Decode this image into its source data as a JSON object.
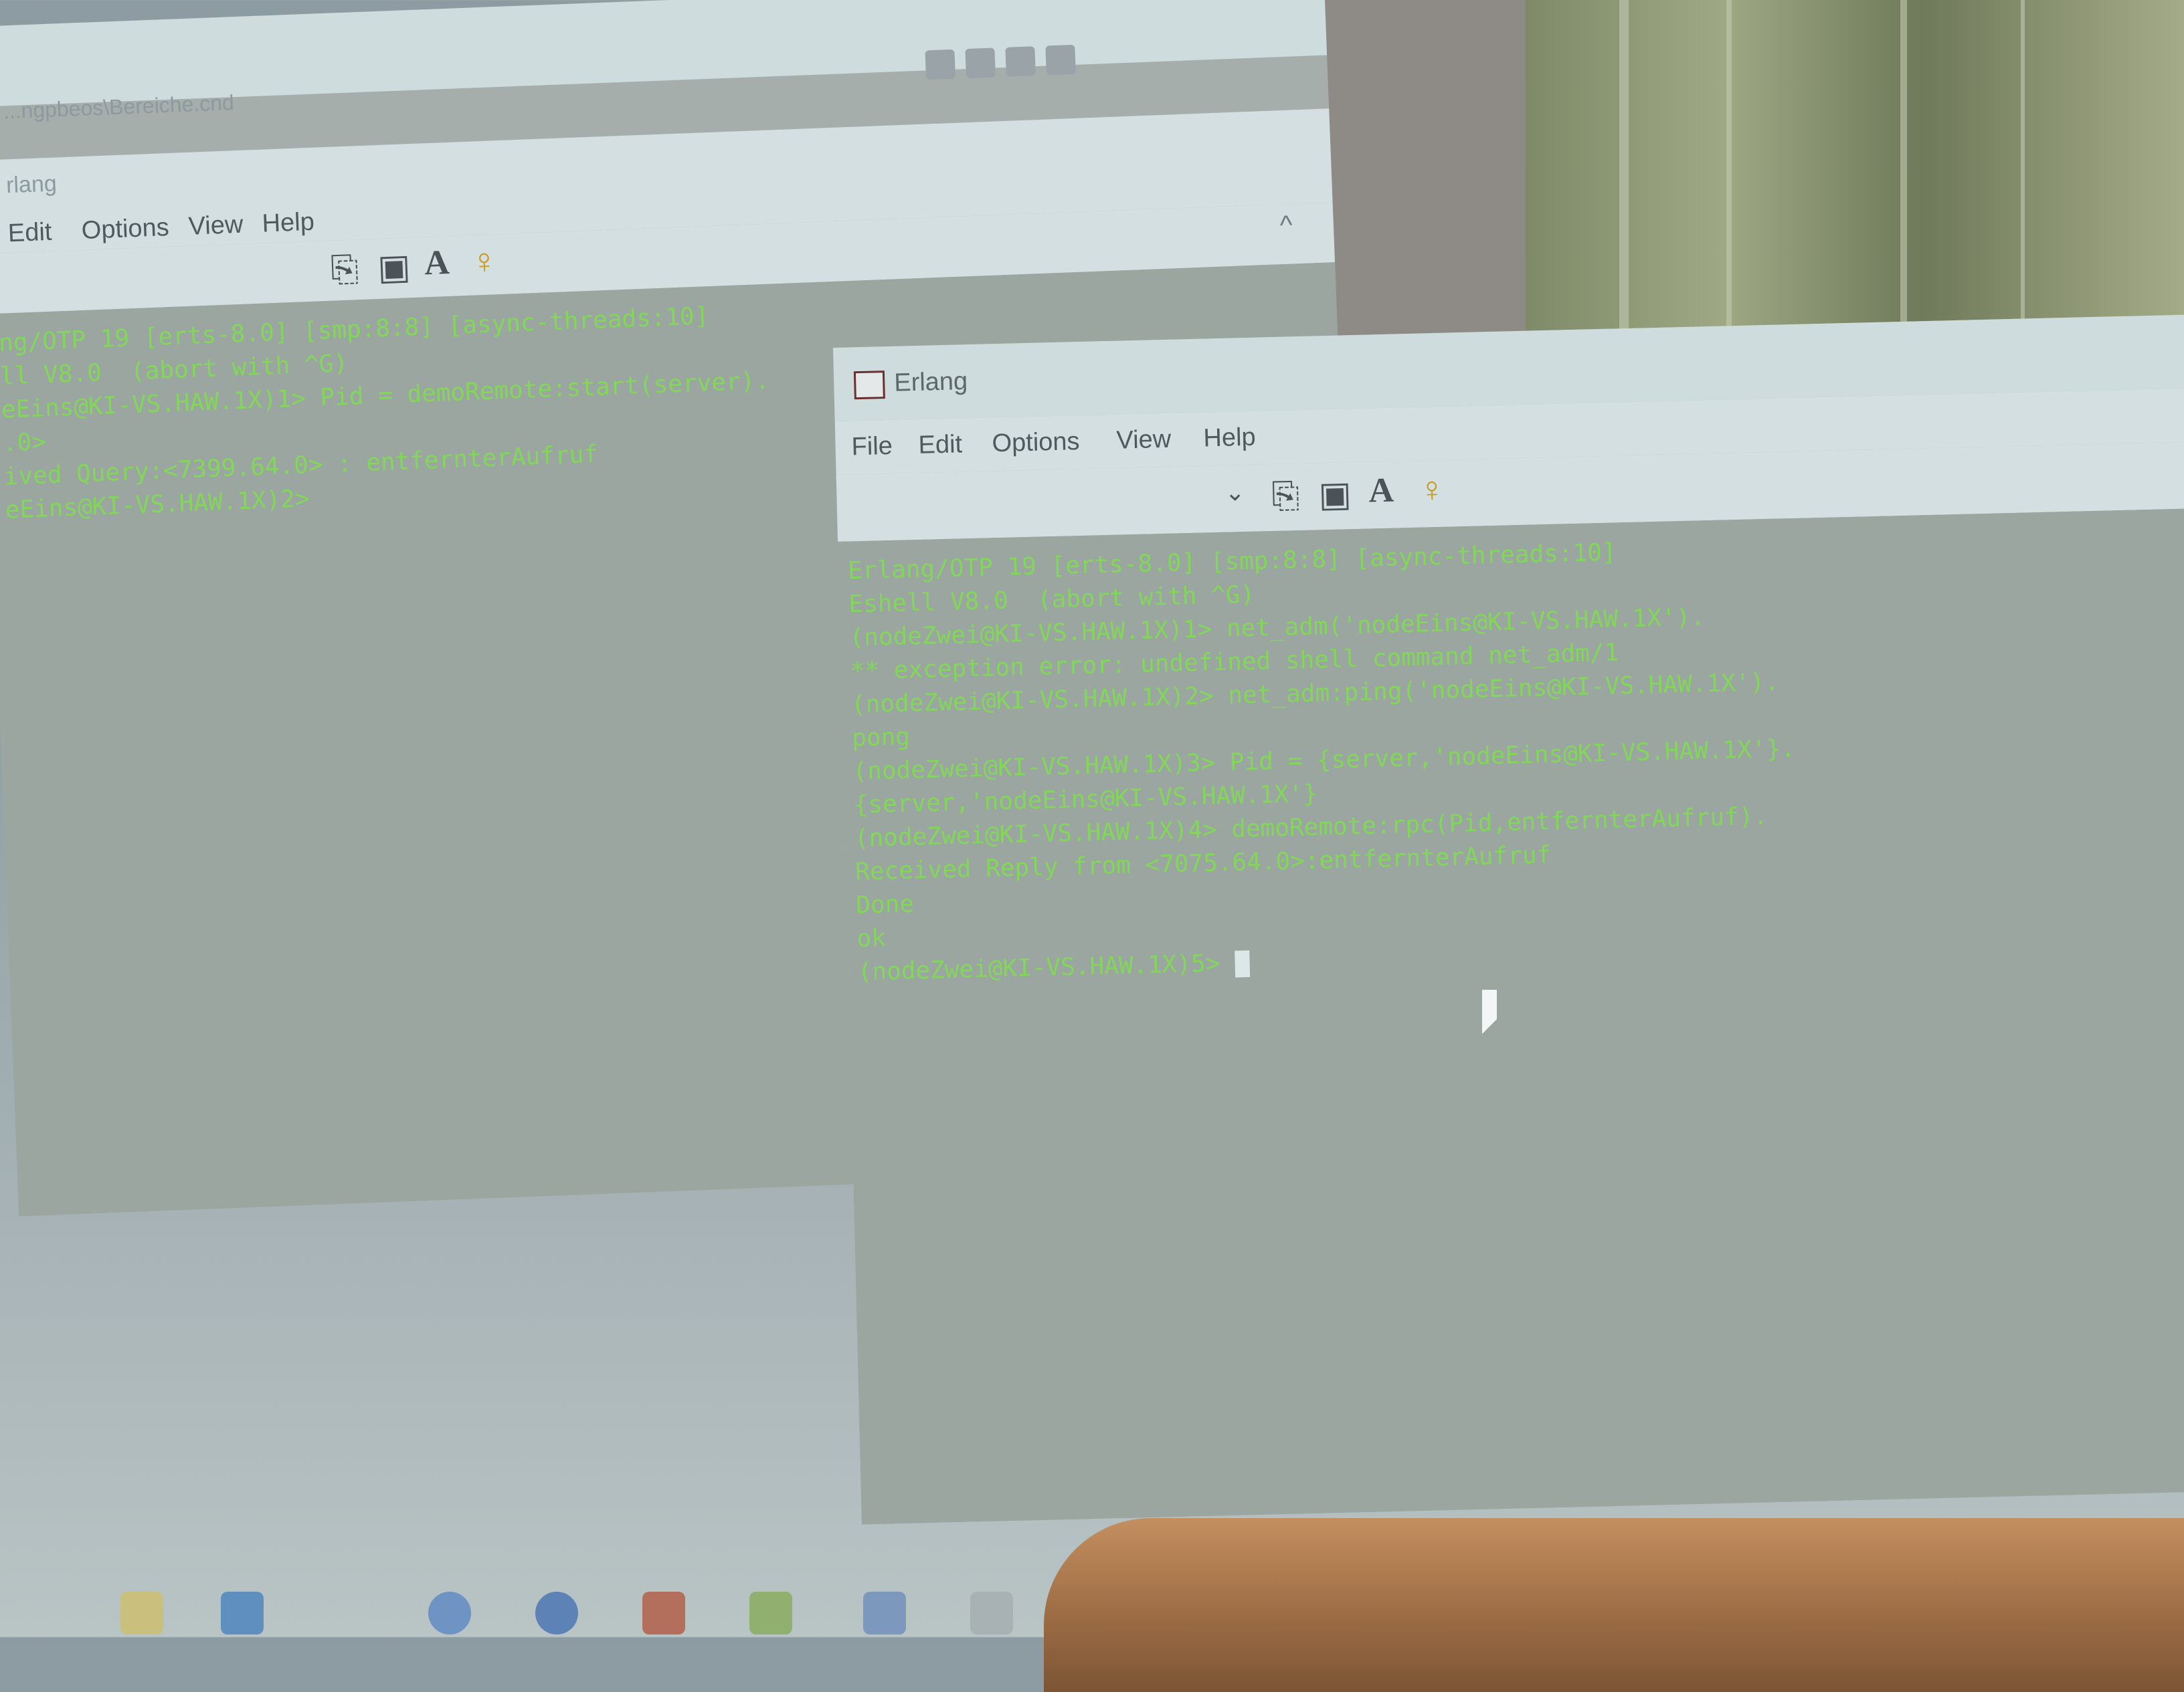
{
  "back_window": {
    "titlebar_path": "...ngpbeos\\Bereiche.cnd",
    "title": "rlang",
    "menu": [
      "Edit",
      "Options",
      "View",
      "Help"
    ],
    "terminal_lines": [
      "ng/OTP 19 [erts-8.0] [smp:8:8] [async-threads:10]",
      "",
      "ll V8.0  (abort with ^G)",
      "eEins@KI-VS.HAW.1X)1> Pid = demoRemote:start(server).",
      ".0>",
      "ived Query:<7399.64.0> : entfernterAufruf",
      "eEins@KI-VS.HAW.1X)2>"
    ]
  },
  "front_window": {
    "title": "Erlang",
    "menu": [
      "File",
      "Edit",
      "Options",
      "View",
      "Help"
    ],
    "toolbar_icons": [
      "copy-icon",
      "paste-icon",
      "font-icon",
      "help-icon"
    ],
    "terminal_lines": [
      "Erlang/OTP 19 [erts-8.0] [smp:8:8] [async-threads:10]",
      "",
      "Eshell V8.0  (abort with ^G)",
      "(nodeZwei@KI-VS.HAW.1X)1> net_adm('nodeEins@KI-VS.HAW.1X').",
      "** exception error: undefined shell command net_adm/1",
      "(nodeZwei@KI-VS.HAW.1X)2> net_adm:ping('nodeEins@KI-VS.HAW.1X').",
      "pong",
      "(nodeZwei@KI-VS.HAW.1X)3> Pid = {server,'nodeEins@KI-VS.HAW.1X'}.",
      "{server,'nodeEins@KI-VS.HAW.1X'}",
      "(nodeZwei@KI-VS.HAW.1X)4> demoRemote:rpc(Pid,entfernterAufruf).",
      "(nodeZwei@KI-VS.HAW.1X)4> demoRemote:rpc(Pid,entfernterAufruf).",
      "Received Reply from <7075.64.0>:entfernterAufruf",
      "Done",
      "ok"
    ],
    "prompt": "(nodeZwei@KI-VS.HAW.1X)5> "
  },
  "colors": {
    "terminal_text": "#7ee04e",
    "terminal_bg": "#9aa69f"
  }
}
